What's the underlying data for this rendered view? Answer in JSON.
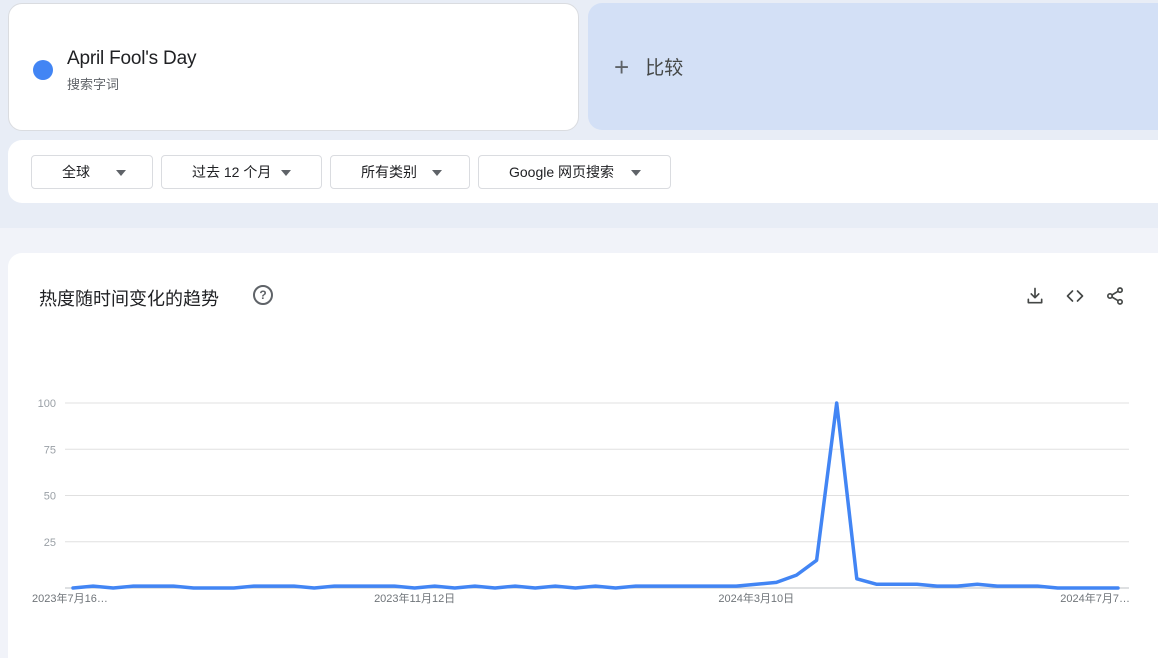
{
  "search_term": {
    "name": "April Fool's Day",
    "type": "搜索字词",
    "color": "#4285f4"
  },
  "compare": {
    "icon": "plus-icon",
    "label": "比较"
  },
  "filters": [
    {
      "label": "全球"
    },
    {
      "label": "过去 12 个月"
    },
    {
      "label": "所有类别"
    },
    {
      "label": "Google 网页搜索"
    }
  ],
  "chart_section": {
    "title": "热度随时间变化的趋势",
    "help_icon": "help-icon",
    "tools": [
      "download-icon",
      "embed-code-icon",
      "share-icon"
    ]
  },
  "chart_data": {
    "type": "line",
    "title": "",
    "xlabel": "",
    "ylabel": "",
    "ylim": [
      0,
      100
    ],
    "yticks": [
      25,
      50,
      75,
      100
    ],
    "grid": true,
    "x_tick_labels": [
      "2023年7月16…",
      "2023年11月12日",
      "2024年3月10日",
      "2024年7月7…"
    ],
    "x_tick_indices": [
      0,
      17,
      34,
      51
    ],
    "series": [
      {
        "name": "",
        "color": "#4285f4",
        "values": [
          0,
          1,
          0,
          1,
          1,
          1,
          0,
          0,
          0,
          1,
          1,
          1,
          0,
          1,
          1,
          1,
          1,
          0,
          1,
          0,
          1,
          0,
          1,
          0,
          1,
          0,
          1,
          0,
          1,
          1,
          1,
          1,
          1,
          1,
          2,
          3,
          7,
          15,
          100,
          5,
          2,
          2,
          2,
          1,
          1,
          2,
          1,
          1,
          1,
          0,
          0,
          0,
          0
        ]
      }
    ]
  }
}
